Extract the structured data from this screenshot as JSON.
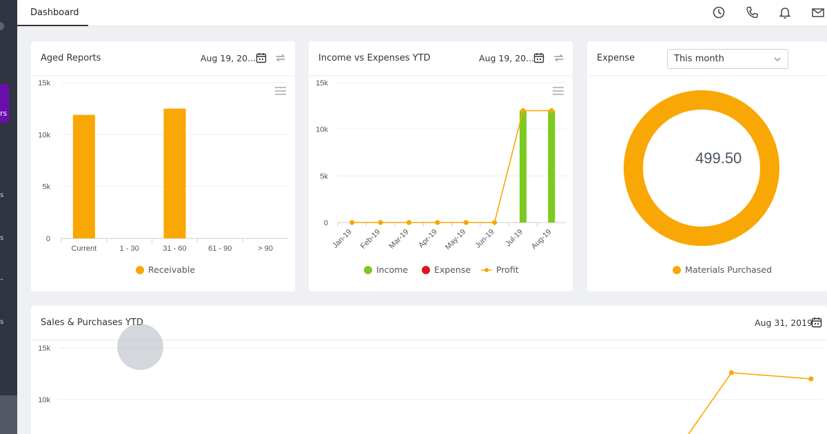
{
  "sidebar": {
    "active_label": "rs",
    "labels": [
      "s",
      "s",
      "–",
      "s"
    ]
  },
  "topbar": {
    "tab_label": "Dashboard",
    "icons": [
      "clock-icon",
      "phone-icon",
      "bell-icon",
      "mail-icon"
    ]
  },
  "colors": {
    "orange": "#f9a704",
    "green": "#7cc91f",
    "red": "#e8101e",
    "sidebar": "#2f3541",
    "accent": "#6a0dad"
  },
  "aged_reports": {
    "title": "Aged Reports",
    "date": "Aug 19, 20...",
    "legend": "Receivable",
    "chart_data": {
      "type": "bar",
      "categories": [
        "Current",
        "1 - 30",
        "31 - 60",
        "61 - 90",
        "> 90"
      ],
      "series": [
        {
          "name": "Receivable",
          "values": [
            11900,
            0,
            12500,
            0,
            0
          ]
        }
      ],
      "ylim": [
        0,
        15000
      ],
      "yticks": [
        "0",
        "5k",
        "10k",
        "15k"
      ],
      "ytick_values": [
        0,
        5000,
        10000,
        15000
      ],
      "grid": true,
      "legend_position": "bottom"
    }
  },
  "income_expenses": {
    "title": "Income vs Expenses YTD",
    "date": "Aug 19, 20...",
    "legend": [
      "Income",
      "Expense",
      "Profit"
    ],
    "chart_data": {
      "type": "bar",
      "categories": [
        "Jan-19",
        "Feb-19",
        "Mar-19",
        "Apr-19",
        "May-19",
        "Jun-19",
        "Jul-19",
        "Aug-19"
      ],
      "series": [
        {
          "name": "Income",
          "type": "bar",
          "values": [
            0,
            0,
            0,
            0,
            0,
            0,
            12000,
            12000
          ]
        },
        {
          "name": "Expense",
          "type": "bar",
          "values": [
            0,
            0,
            0,
            0,
            0,
            0,
            0,
            0
          ]
        },
        {
          "name": "Profit",
          "type": "line",
          "values": [
            0,
            0,
            0,
            0,
            0,
            0,
            12000,
            12000
          ]
        }
      ],
      "ylim": [
        0,
        15000
      ],
      "yticks": [
        "0",
        "5k",
        "10k",
        "15k"
      ],
      "ytick_values": [
        0,
        5000,
        10000,
        15000
      ],
      "grid": true,
      "legend_position": "bottom"
    }
  },
  "expense": {
    "title": "Expense",
    "select_value": "This month",
    "center_value": "499.50",
    "legend": "Materials Purchased",
    "chart_data": {
      "type": "pie",
      "categories": [
        "Materials Purchased"
      ],
      "values": [
        499.5
      ],
      "legend_position": "bottom"
    }
  },
  "sales_purchases": {
    "title": "Sales & Purchases YTD",
    "date": "Aug 31, 2019",
    "chart_data": {
      "type": "line",
      "series": [
        {
          "name": "",
          "values": [
            12600,
            12000
          ]
        }
      ],
      "visible_x_fraction": [
        0.88,
        0.98
      ],
      "ylim": [
        0,
        15000
      ],
      "yticks": [
        "10k",
        "15k"
      ],
      "ytick_values": [
        10000,
        15000
      ],
      "grid": true
    }
  }
}
